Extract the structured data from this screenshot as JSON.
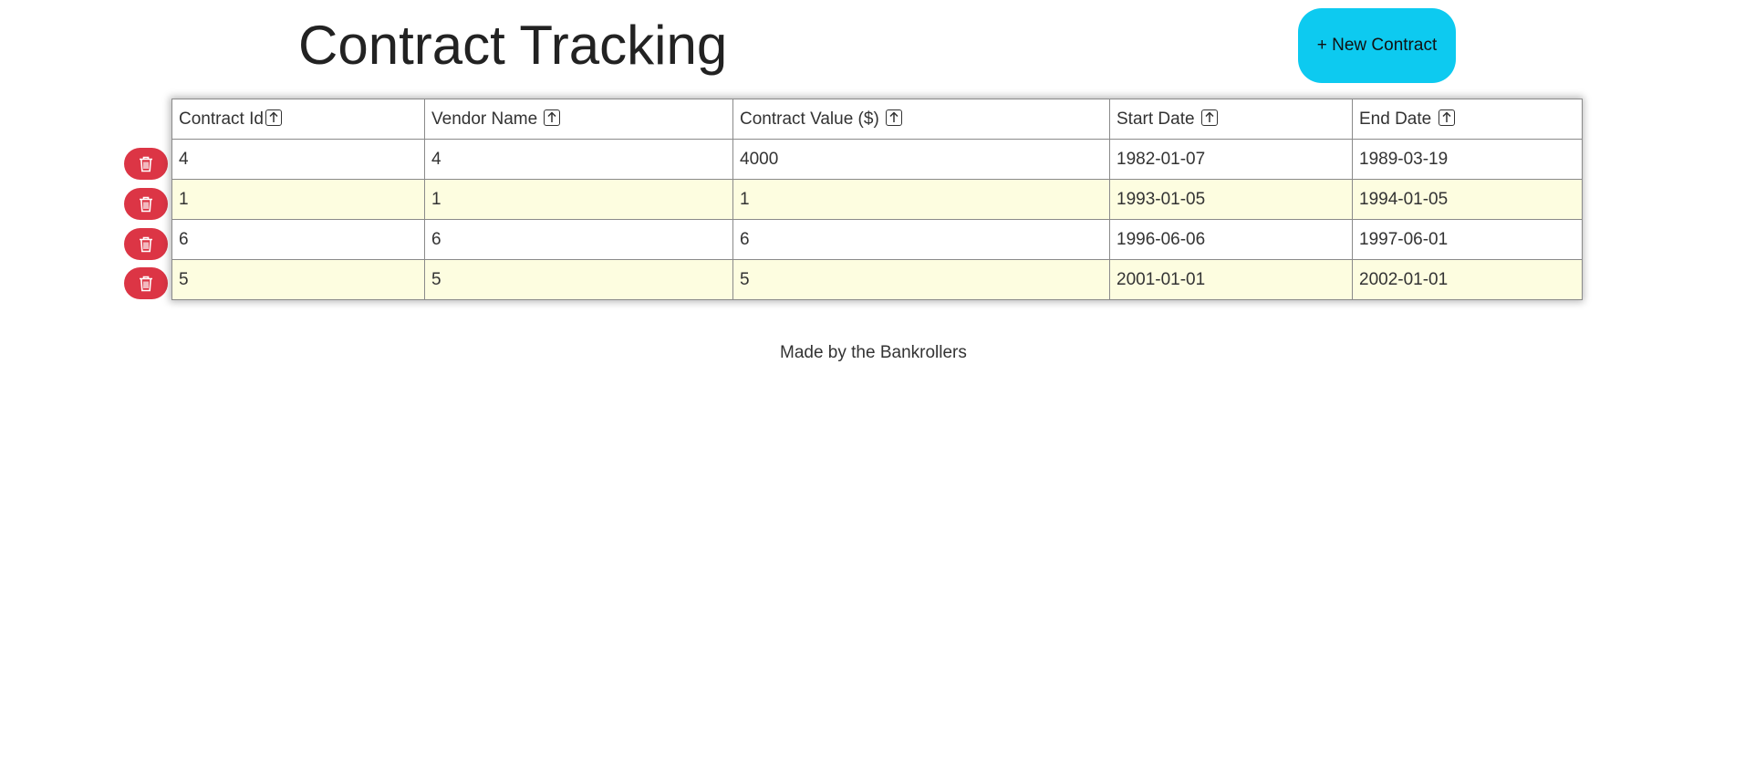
{
  "header": {
    "title": "Contract Tracking",
    "new_contract_label": "+ New Contract"
  },
  "table": {
    "columns": [
      {
        "label": "Contract Id",
        "sort_icon": "sort-arrow-up-icon"
      },
      {
        "label": "Vendor Name",
        "sort_icon": "sort-arrow-up-icon"
      },
      {
        "label": "Contract Value ($)",
        "sort_icon": "sort-arrow-up-icon"
      },
      {
        "label": "Start Date",
        "sort_icon": "sort-arrow-up-icon"
      },
      {
        "label": "End Date",
        "sort_icon": "sort-arrow-up-icon"
      }
    ],
    "rows": [
      [
        "4",
        "4",
        "4000",
        "1982-01-07",
        "1989-03-19"
      ],
      [
        "1",
        "1",
        "1",
        "1993-01-05",
        "1994-01-05"
      ],
      [
        "6",
        "6",
        "6",
        "1996-06-06",
        "1997-06-01"
      ],
      [
        "5",
        "5",
        "5",
        "2001-01-01",
        "2002-01-01"
      ]
    ]
  },
  "row_action_icon": "trash-icon",
  "footer": {
    "text": "Made by the Bankrollers"
  },
  "colors": {
    "primary_button": "#0dcaf0",
    "delete_button": "#dc3545",
    "striped_row": "#fdfde0"
  }
}
